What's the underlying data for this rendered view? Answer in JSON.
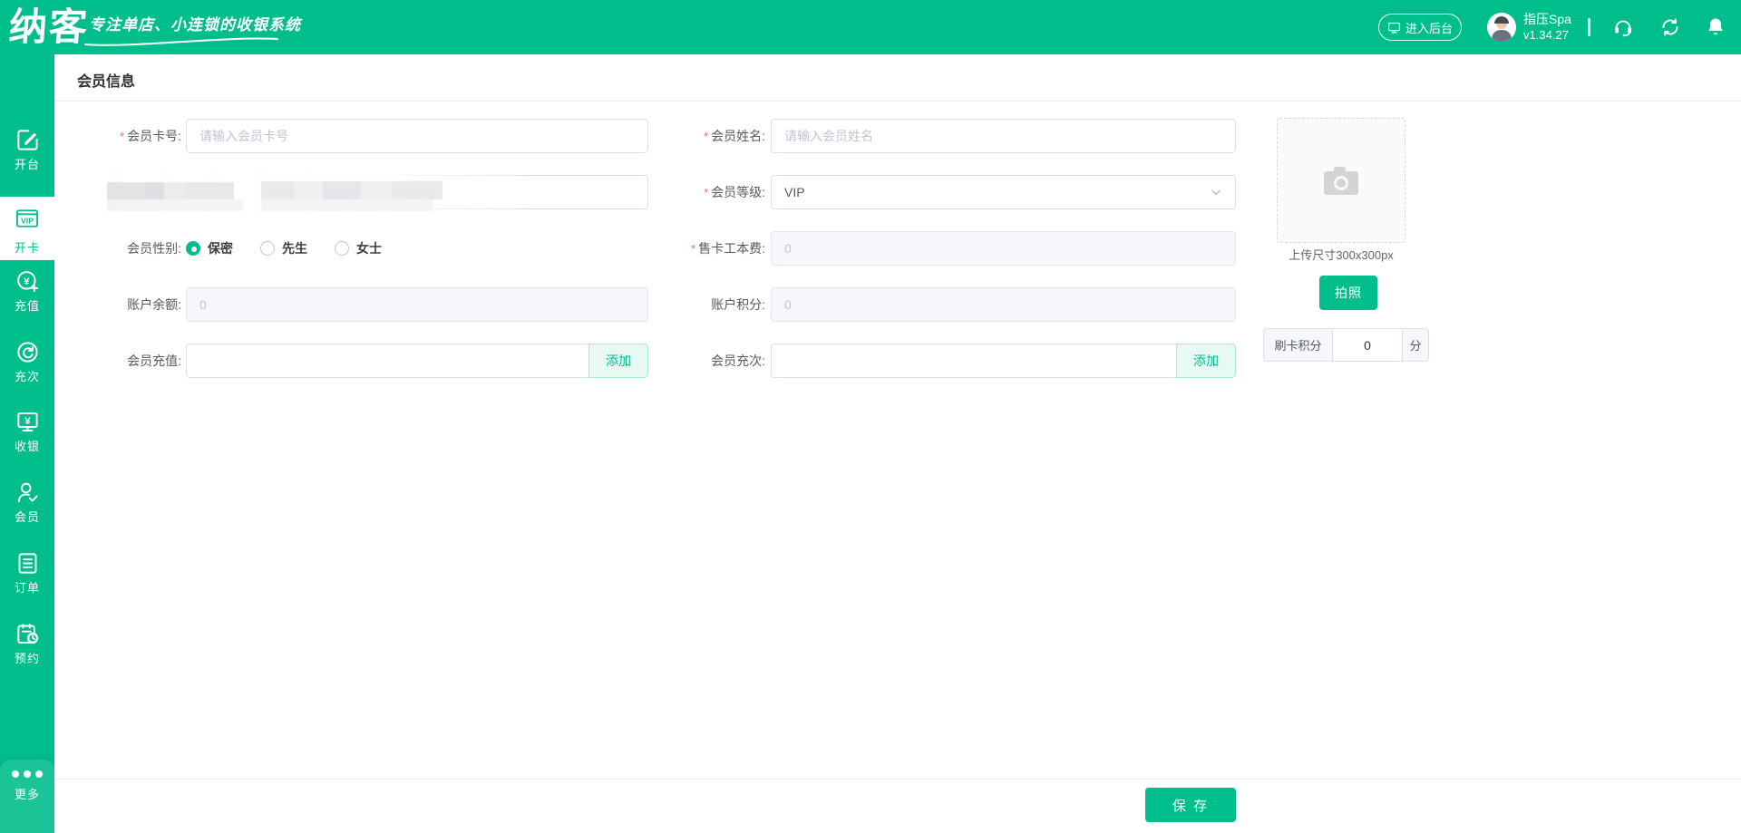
{
  "brand": {
    "logo": "纳客",
    "tagline": "专注单店、小连锁的收银系统"
  },
  "topbar": {
    "enter_backend": "进入后台",
    "store_name": "指压Spa",
    "version": "v1.34.27",
    "icons": [
      "monitor-icon",
      "headset-icon",
      "sync-icon",
      "bell-icon"
    ]
  },
  "sidebar": {
    "items": [
      {
        "label": "开台",
        "icon": "edit-square-icon",
        "active": false
      },
      {
        "label": "开卡",
        "icon": "vip-card-icon",
        "badge": "VIP",
        "active": true
      },
      {
        "label": "充值",
        "icon": "recharge-yuan-plus-icon",
        "active": false
      },
      {
        "label": "充次",
        "icon": "refill-times-rotate-icon",
        "active": false
      },
      {
        "label": "收银",
        "icon": "cashier-monitor-yuan-icon",
        "active": false
      },
      {
        "label": "会员",
        "icon": "member-check-icon",
        "active": false
      },
      {
        "label": "订单",
        "icon": "order-clipboard-icon",
        "active": false
      },
      {
        "label": "预约",
        "icon": "booking-clock-icon",
        "active": false
      }
    ],
    "more_label": "更多"
  },
  "page": {
    "title": "会员信息",
    "required_mark": "*"
  },
  "form": {
    "card_no": {
      "label": "会员卡号:",
      "required": true,
      "placeholder": "请输入会员卡号",
      "value": ""
    },
    "name": {
      "label": "会员姓名:",
      "required": true,
      "placeholder": "请输入会员姓名",
      "value": ""
    },
    "level": {
      "label": "会员等级:",
      "required": true,
      "value": "VIP"
    },
    "gender": {
      "label": "会员性别:",
      "options": [
        "保密",
        "先生",
        "女士"
      ],
      "selected": "保密"
    },
    "card_fee": {
      "label": "售卡工本费:",
      "required": true,
      "value": "0",
      "disabled": true
    },
    "balance": {
      "label": "账户余额:",
      "value": "0",
      "disabled": true
    },
    "points": {
      "label": "账户积分:",
      "value": "0",
      "disabled": true
    },
    "recharge": {
      "label": "会员充值:",
      "value": "",
      "button": "添加"
    },
    "recharge_times": {
      "label": "会员充次:",
      "value": "",
      "button": "添加"
    }
  },
  "photo": {
    "icon": "camera-icon",
    "hint": "上传尺寸300x300px",
    "take_photo": "拍照"
  },
  "swipe_points": {
    "label": "刷卡积分",
    "value": "0",
    "unit": "分"
  },
  "footer": {
    "save": "保 存"
  },
  "colors": {
    "brand_green": "#00be8c",
    "light_green_bg": "#e7f9f2",
    "border": "#dcdfe6",
    "disabled_bg": "#f5f7fa",
    "placeholder": "#c0c4cc",
    "required_red": "#f56c6c"
  }
}
